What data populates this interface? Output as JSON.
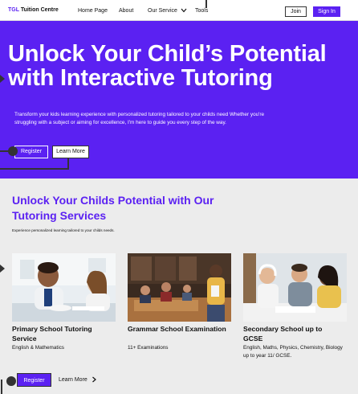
{
  "header": {
    "logo_brand": "TGL",
    "logo_rest": " Tuition Centre",
    "nav": {
      "home": "Home Page",
      "about": "About",
      "service": "Our Service",
      "tools": "Tools"
    },
    "join_label": "Join",
    "signin_label": "Sign In"
  },
  "hero": {
    "title": "Unlock Your Child’s Potential with Interactive Tutoring",
    "text": "Transform your kids learning experience with personalized tutoring tailored to your childs need Whether you're struggling with a subject or aiming for excellence, I'm here to guide you every step of the way.",
    "register_label": "Register",
    "learn_label": "Learn More"
  },
  "services": {
    "title": "Unlock Your Childs Potential with Our Tutoring Services",
    "subtitle": "Experience personalized learning tailored to your childs needs.",
    "cards": [
      {
        "title": "Primary School Tutoring Service",
        "desc": "English & Mathematics"
      },
      {
        "title": "Grammar School Examination",
        "desc": "11+ Examinations"
      },
      {
        "title": "Secondary School up to GCSE",
        "desc": "English, Maths, Physics, Chemistry, Biology up to year 11/ GCSE."
      }
    ],
    "register_label": "Register",
    "learn_label": "Learn More"
  },
  "colors": {
    "accent": "#5b21f2",
    "background": "#ececec"
  },
  "icons": {
    "dropdown": "chevron-down-icon",
    "learn_more": "chevron-right-icon"
  }
}
